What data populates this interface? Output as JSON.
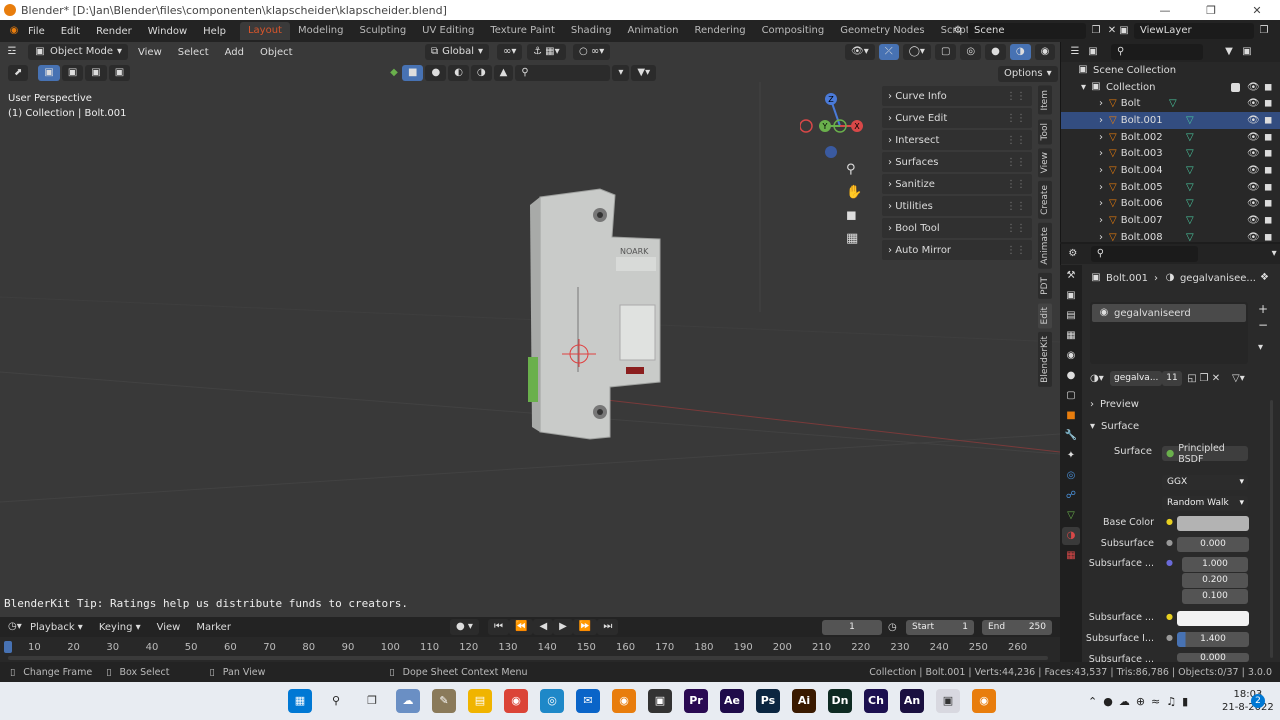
{
  "window": {
    "title": "Blender* [D:\\Jan\\Blender\\files\\componenten\\klapscheider\\klapscheider.blend]"
  },
  "menu": [
    "File",
    "Edit",
    "Render",
    "Window",
    "Help"
  ],
  "workspaces": [
    "Layout",
    "Modeling",
    "Sculpting",
    "UV Editing",
    "Texture Paint",
    "Shading",
    "Animation",
    "Rendering",
    "Compositing",
    "Geometry Nodes",
    "Scripting"
  ],
  "scene": "Scene",
  "view_layer": "ViewLayer",
  "viewport": {
    "mode": "Object Mode",
    "menus": [
      "View",
      "Select",
      "Add",
      "Object"
    ],
    "transform": "Global",
    "options": "Options",
    "perspective": "User Perspective",
    "collection_info": "(1) Collection | Bolt.001",
    "tip": "BlenderKit Tip: Ratings help us distribute funds to creators.",
    "model_label": "NOARK"
  },
  "npanel": {
    "items": [
      "Curve Info",
      "Curve Edit",
      "Intersect",
      "Surfaces",
      "Sanitize",
      "Utilities",
      "Bool Tool",
      "Auto Mirror"
    ],
    "tabs": [
      "Item",
      "Tool",
      "View",
      "Create",
      "Animate",
      "PDT",
      "Edit",
      "BlenderKit"
    ]
  },
  "gizmo": {
    "z": "Z",
    "y": "Y",
    "x": "X"
  },
  "outliner": {
    "root": "Scene Collection",
    "collection": "Collection",
    "items": [
      "Bolt",
      "Bolt.001",
      "Bolt.002",
      "Bolt.003",
      "Bolt.004",
      "Bolt.005",
      "Bolt.006",
      "Bolt.007",
      "Bolt.008"
    ],
    "selected_index": 1
  },
  "properties": {
    "breadcrumb_object": "Bolt.001",
    "breadcrumb_material": "gegalvanisee...",
    "slot": "gegalvaniseerd",
    "material_name": "gegalva...",
    "users": "11",
    "preview": "Preview",
    "surface_section": "Surface",
    "surface_label": "Surface",
    "surface_value": "Principled BSDF",
    "distribution": "GGX",
    "subsurface_method": "Random Walk",
    "base_color_label": "Base Color",
    "subsurface_label": "Subsurface",
    "subsurface_value": "0.000",
    "subsurface_radius_label": "Subsurface ...",
    "radius": [
      "1.000",
      "0.200",
      "0.100"
    ],
    "subsurface_color_label": "Subsurface ...",
    "subsurface_ior_label": "Subsurface I...",
    "subsurface_ior_value": "1.400",
    "subsurface_anis_label": "Subsurface ...",
    "subsurface_anis_value": "0.000"
  },
  "timeline": {
    "menus": [
      "Playback",
      "Keying",
      "View",
      "Marker"
    ],
    "current_frame": "1",
    "start_label": "Start",
    "start": "1",
    "end_label": "End",
    "end": "250",
    "ticks": [
      "10",
      "20",
      "30",
      "40",
      "50",
      "60",
      "70",
      "80",
      "90",
      "100",
      "110",
      "120",
      "130",
      "140",
      "150",
      "160",
      "170",
      "180",
      "190",
      "200",
      "210",
      "220",
      "230",
      "240",
      "250",
      "260"
    ]
  },
  "statusbar": {
    "change_frame": "Change Frame",
    "box_select": "Box Select",
    "pan_view": "Pan View",
    "context_menu": "Dope Sheet Context Menu",
    "stats": "Collection | Bolt.001 | Verts:44,236 | Faces:43,537 | Tris:86,786 | Objects:0/37 | 3.0.0"
  },
  "taskbar": {
    "apps": [
      {
        "label": "Pr",
        "color": "#2a0a52"
      },
      {
        "label": "Ae",
        "color": "#1f0b4a"
      },
      {
        "label": "Ps",
        "color": "#0b2540"
      },
      {
        "label": "Ai",
        "color": "#3a1a00"
      },
      {
        "label": "Dn",
        "color": "#0e2a22"
      },
      {
        "label": "Ch",
        "color": "#1c1050"
      },
      {
        "label": "An",
        "color": "#1a1040"
      }
    ],
    "time": "18:03",
    "date": "21-8-2022",
    "notifications": "2"
  }
}
